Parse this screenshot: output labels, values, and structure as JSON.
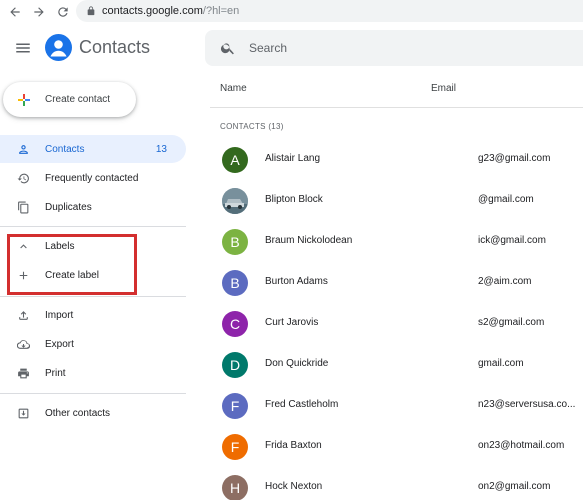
{
  "browser": {
    "url_host": "contacts.google.com",
    "url_path": "/?hl=en"
  },
  "header": {
    "app_title": "Contacts",
    "search_placeholder": "Search"
  },
  "create_button": {
    "label": "Create contact"
  },
  "sidebar": {
    "items": [
      {
        "label": "Contacts",
        "icon": "person-icon",
        "count": "13",
        "active": true
      },
      {
        "label": "Frequently contacted",
        "icon": "history-icon"
      },
      {
        "label": "Duplicates",
        "icon": "duplicate-icon"
      }
    ],
    "labels_section": [
      {
        "label": "Labels",
        "icon": "chevron-up-icon"
      },
      {
        "label": "Create label",
        "icon": "plus-icon"
      }
    ],
    "tools": [
      {
        "label": "Import",
        "icon": "upload-icon"
      },
      {
        "label": "Export",
        "icon": "cloud-download-icon"
      },
      {
        "label": "Print",
        "icon": "print-icon"
      }
    ],
    "other": [
      {
        "label": "Other contacts",
        "icon": "archive-icon"
      }
    ]
  },
  "list": {
    "columns": {
      "name": "Name",
      "email": "Email"
    },
    "section_title": "CONTACTS (13)",
    "rows": [
      {
        "initial": "A",
        "name": "Alistair Lang",
        "email": "g23@gmail.com",
        "color": "#33691e"
      },
      {
        "initial": "",
        "name": "Blipton Block",
        "email": "@gmail.com",
        "color": "#607d8b",
        "photo": true
      },
      {
        "initial": "B",
        "name": "Braum Nickolodean",
        "email": "ick@gmail.com",
        "color": "#7cb342"
      },
      {
        "initial": "B",
        "name": "Burton Adams",
        "email": "2@aim.com",
        "color": "#5c6bc0"
      },
      {
        "initial": "C",
        "name": "Curt Jarovis",
        "email": "s2@gmail.com",
        "color": "#8e24aa"
      },
      {
        "initial": "D",
        "name": "Don Quickride",
        "email": "gmail.com",
        "color": "#00796b"
      },
      {
        "initial": "F",
        "name": "Fred Castleholm",
        "email": "n23@serversusa.co...",
        "color": "#5c6bc0"
      },
      {
        "initial": "F",
        "name": "Frida Baxton",
        "email": "on23@hotmail.com",
        "color": "#ef6c00"
      },
      {
        "initial": "H",
        "name": "Hock Nexton",
        "email": "on2@gmail.com",
        "color": "#8d6e63"
      }
    ]
  },
  "colors": {
    "accent": "#1a73e8",
    "active_bg": "#e8f0fe",
    "highlight_box": "#d32f2f"
  }
}
